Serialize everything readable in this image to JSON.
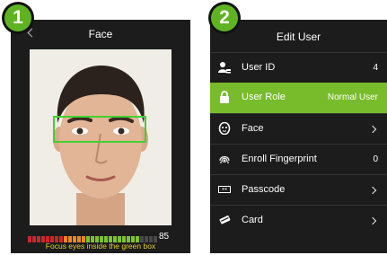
{
  "badges": [
    "1",
    "2"
  ],
  "capture": {
    "title": "Face",
    "quality_value": "85",
    "quality_fraction": 0.85,
    "hint": "Focus eyes inside the green box",
    "colors": {
      "panel": "#1c1c1c",
      "guide_box": "#43d030",
      "hint_text": "#e6cd2a"
    }
  },
  "edit_user": {
    "title": "Edit User",
    "selected_color": "#78bb2b",
    "items": [
      {
        "label": "User ID",
        "value": "4",
        "icon": "user-id-icon"
      },
      {
        "label": "User Role",
        "value": "Normal User",
        "icon": "lock-icon"
      },
      {
        "label": "Face",
        "value": "",
        "icon": "face-icon"
      },
      {
        "label": "Enroll Fingerprint",
        "value": "0",
        "icon": "fingerprint-icon"
      },
      {
        "label": "Passcode",
        "value": "",
        "icon": "passcode-icon"
      },
      {
        "label": "Card",
        "value": "",
        "icon": "card-icon"
      }
    ]
  }
}
